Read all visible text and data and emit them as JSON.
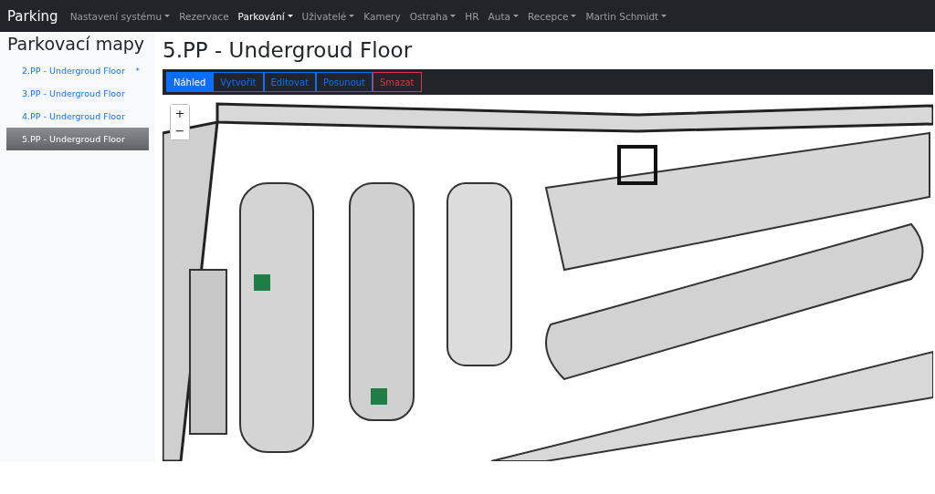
{
  "navbar": {
    "brand": "Parking",
    "items": [
      {
        "label": "Nastavení systému",
        "dropdown": true,
        "selected": false
      },
      {
        "label": "Rezervace",
        "dropdown": false,
        "selected": false
      },
      {
        "label": "Parkování",
        "dropdown": true,
        "selected": true
      },
      {
        "label": "Uživatelé",
        "dropdown": true,
        "selected": false
      },
      {
        "label": "Kamery",
        "dropdown": false,
        "selected": false
      },
      {
        "label": "Ostraha",
        "dropdown": true,
        "selected": false
      },
      {
        "label": "HR",
        "dropdown": false,
        "selected": false
      },
      {
        "label": "Auta",
        "dropdown": true,
        "selected": false
      },
      {
        "label": "Recepce",
        "dropdown": true,
        "selected": false
      },
      {
        "label": "Martin Schmidt",
        "dropdown": true,
        "selected": false
      }
    ]
  },
  "sidebar": {
    "title": "Parkovací mapy",
    "items": [
      {
        "label": "2.PP - Undergroud Floor",
        "marker": "*",
        "selected": false
      },
      {
        "label": "3.PP - Undergroud Floor",
        "selected": false
      },
      {
        "label": "4.PP - Undergroud Floor",
        "selected": false
      },
      {
        "label": "5.PP - Undergroud Floor",
        "selected": true
      }
    ]
  },
  "main": {
    "title": "5.PP - Undergroud Floor",
    "toolbar": [
      {
        "label": "Náhled",
        "kind": "primary",
        "selected": true
      },
      {
        "label": "Vytvořit",
        "kind": "primary",
        "selected": false
      },
      {
        "label": "Editovat",
        "kind": "primary",
        "selected": false
      },
      {
        "label": "Posunout",
        "kind": "primary",
        "selected": false
      },
      {
        "label": "Smazat",
        "kind": "danger",
        "selected": false
      }
    ],
    "map": {
      "kind": "picture",
      "zoom_controls": [
        "+",
        "−"
      ]
    }
  }
}
